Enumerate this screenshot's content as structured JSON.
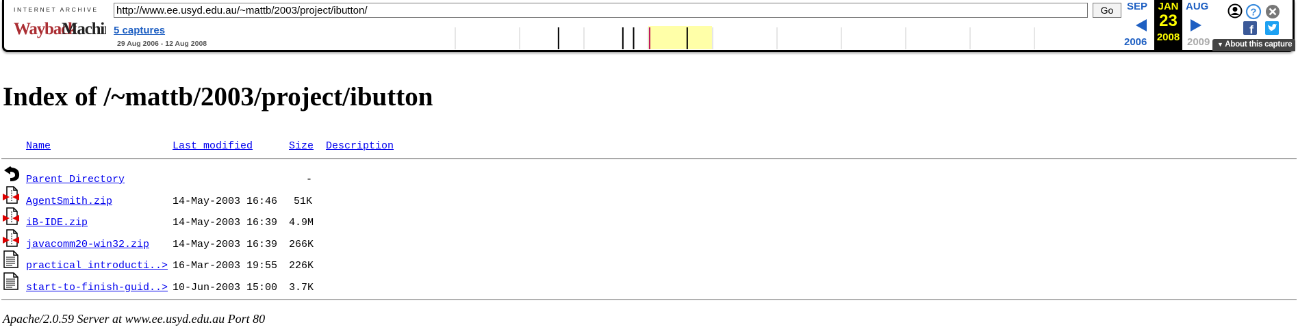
{
  "wayback": {
    "brand_top": "INTERNET ARCHIVE",
    "brand_logo": "WaybackMachine",
    "url": "http://www.ee.usyd.edu.au/~mattb/2003/project/ibutton/",
    "go_label": "Go",
    "captures_label": "5 captures",
    "captures_range": "29 Aug 2006 - 12 Aug 2008",
    "prev_month": "SEP",
    "current_month": "JAN",
    "next_month": "AUG",
    "current_day": "23",
    "prev_year": "2006",
    "current_year": "2008",
    "next_year": "2009",
    "about_label": "About this capture",
    "icons": [
      "user-icon",
      "help-icon",
      "close-icon",
      "facebook-icon",
      "twitter-icon"
    ]
  },
  "listing": {
    "title": "Index of /~mattb/2003/project/ibutton",
    "headers": {
      "name": "Name",
      "last_modified": "Last modified",
      "size": "Size",
      "description": "Description"
    },
    "rows": [
      {
        "icon": "back-icon",
        "name": "Parent Directory",
        "modified": "",
        "size": "-"
      },
      {
        "icon": "compressed-file-icon",
        "name": "AgentSmith.zip",
        "modified": "14-May-2003 16:46",
        "size": "51K"
      },
      {
        "icon": "compressed-file-icon",
        "name": "iB-IDE.zip",
        "modified": "14-May-2003 16:39",
        "size": "4.9M"
      },
      {
        "icon": "compressed-file-icon",
        "name": "javacomm20-win32.zip",
        "modified": "14-May-2003 16:39",
        "size": "266K"
      },
      {
        "icon": "text-file-icon",
        "name": "practical_introducti..>",
        "modified": "16-Mar-2003 19:55",
        "size": "226K"
      },
      {
        "icon": "text-file-icon",
        "name": "start-to-finish-guid..>",
        "modified": "10-Jun-2003 15:00",
        "size": "3.7K"
      }
    ],
    "footer": "Apache/2.0.59 Server at www.ee.usyd.edu.au Port 80"
  },
  "colors": {
    "link": "#0000ee",
    "wayback_blue": "#1e5fc2",
    "current_capture_bg": "#000000",
    "current_capture_text": "#ffff00"
  }
}
